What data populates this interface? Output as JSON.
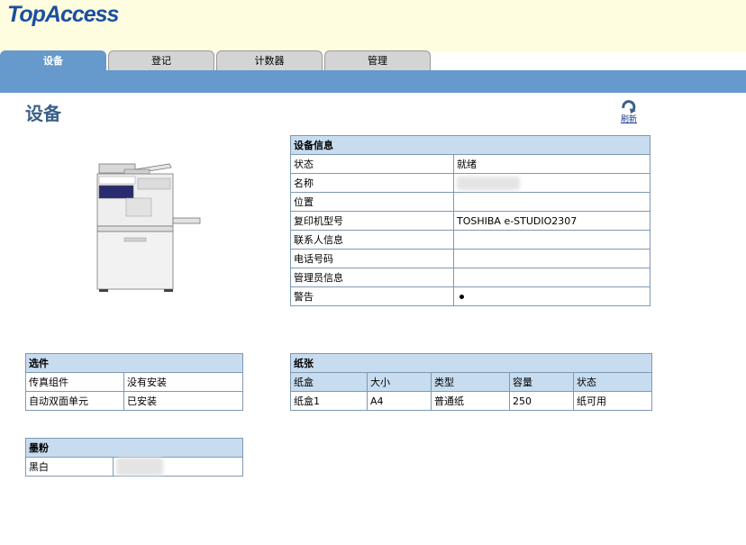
{
  "app": {
    "logo": "TopAccess"
  },
  "tabs": [
    {
      "label": "设备",
      "active": true
    },
    {
      "label": "登记",
      "active": false
    },
    {
      "label": "计数器",
      "active": false
    },
    {
      "label": "管理",
      "active": false
    }
  ],
  "page": {
    "title": "设备",
    "refresh_label": "刷新"
  },
  "device_info": {
    "header": "设备信息",
    "rows": [
      {
        "label": "状态",
        "value": "就绪"
      },
      {
        "label": "名称",
        "value": ""
      },
      {
        "label": "位置",
        "value": ""
      },
      {
        "label": "复印机型号",
        "value": "TOSHIBA e-STUDIO2307"
      },
      {
        "label": "联系人信息",
        "value": ""
      },
      {
        "label": "电话号码",
        "value": ""
      },
      {
        "label": "管理员信息",
        "value": ""
      },
      {
        "label": "警告",
        "value": ""
      }
    ]
  },
  "options": {
    "header": "选件",
    "rows": [
      {
        "label": "传真组件",
        "value": "没有安装"
      },
      {
        "label": "自动双面单元",
        "value": "已安装"
      }
    ]
  },
  "toner": {
    "header": "墨粉",
    "rows": [
      {
        "label": "黑白",
        "value": ""
      }
    ]
  },
  "paper": {
    "header": "纸张",
    "columns": [
      "纸盒",
      "大小",
      "类型",
      "容量",
      "状态"
    ],
    "rows": [
      [
        "纸盒1",
        "A4",
        "普通纸",
        "250",
        "纸可用"
      ]
    ]
  },
  "colors": {
    "accent": "#6699cc",
    "header_bg": "#fefde0",
    "table_header": "#c7dcef"
  },
  "icons": {
    "refresh": "refresh-icon",
    "device": "printer-image"
  }
}
